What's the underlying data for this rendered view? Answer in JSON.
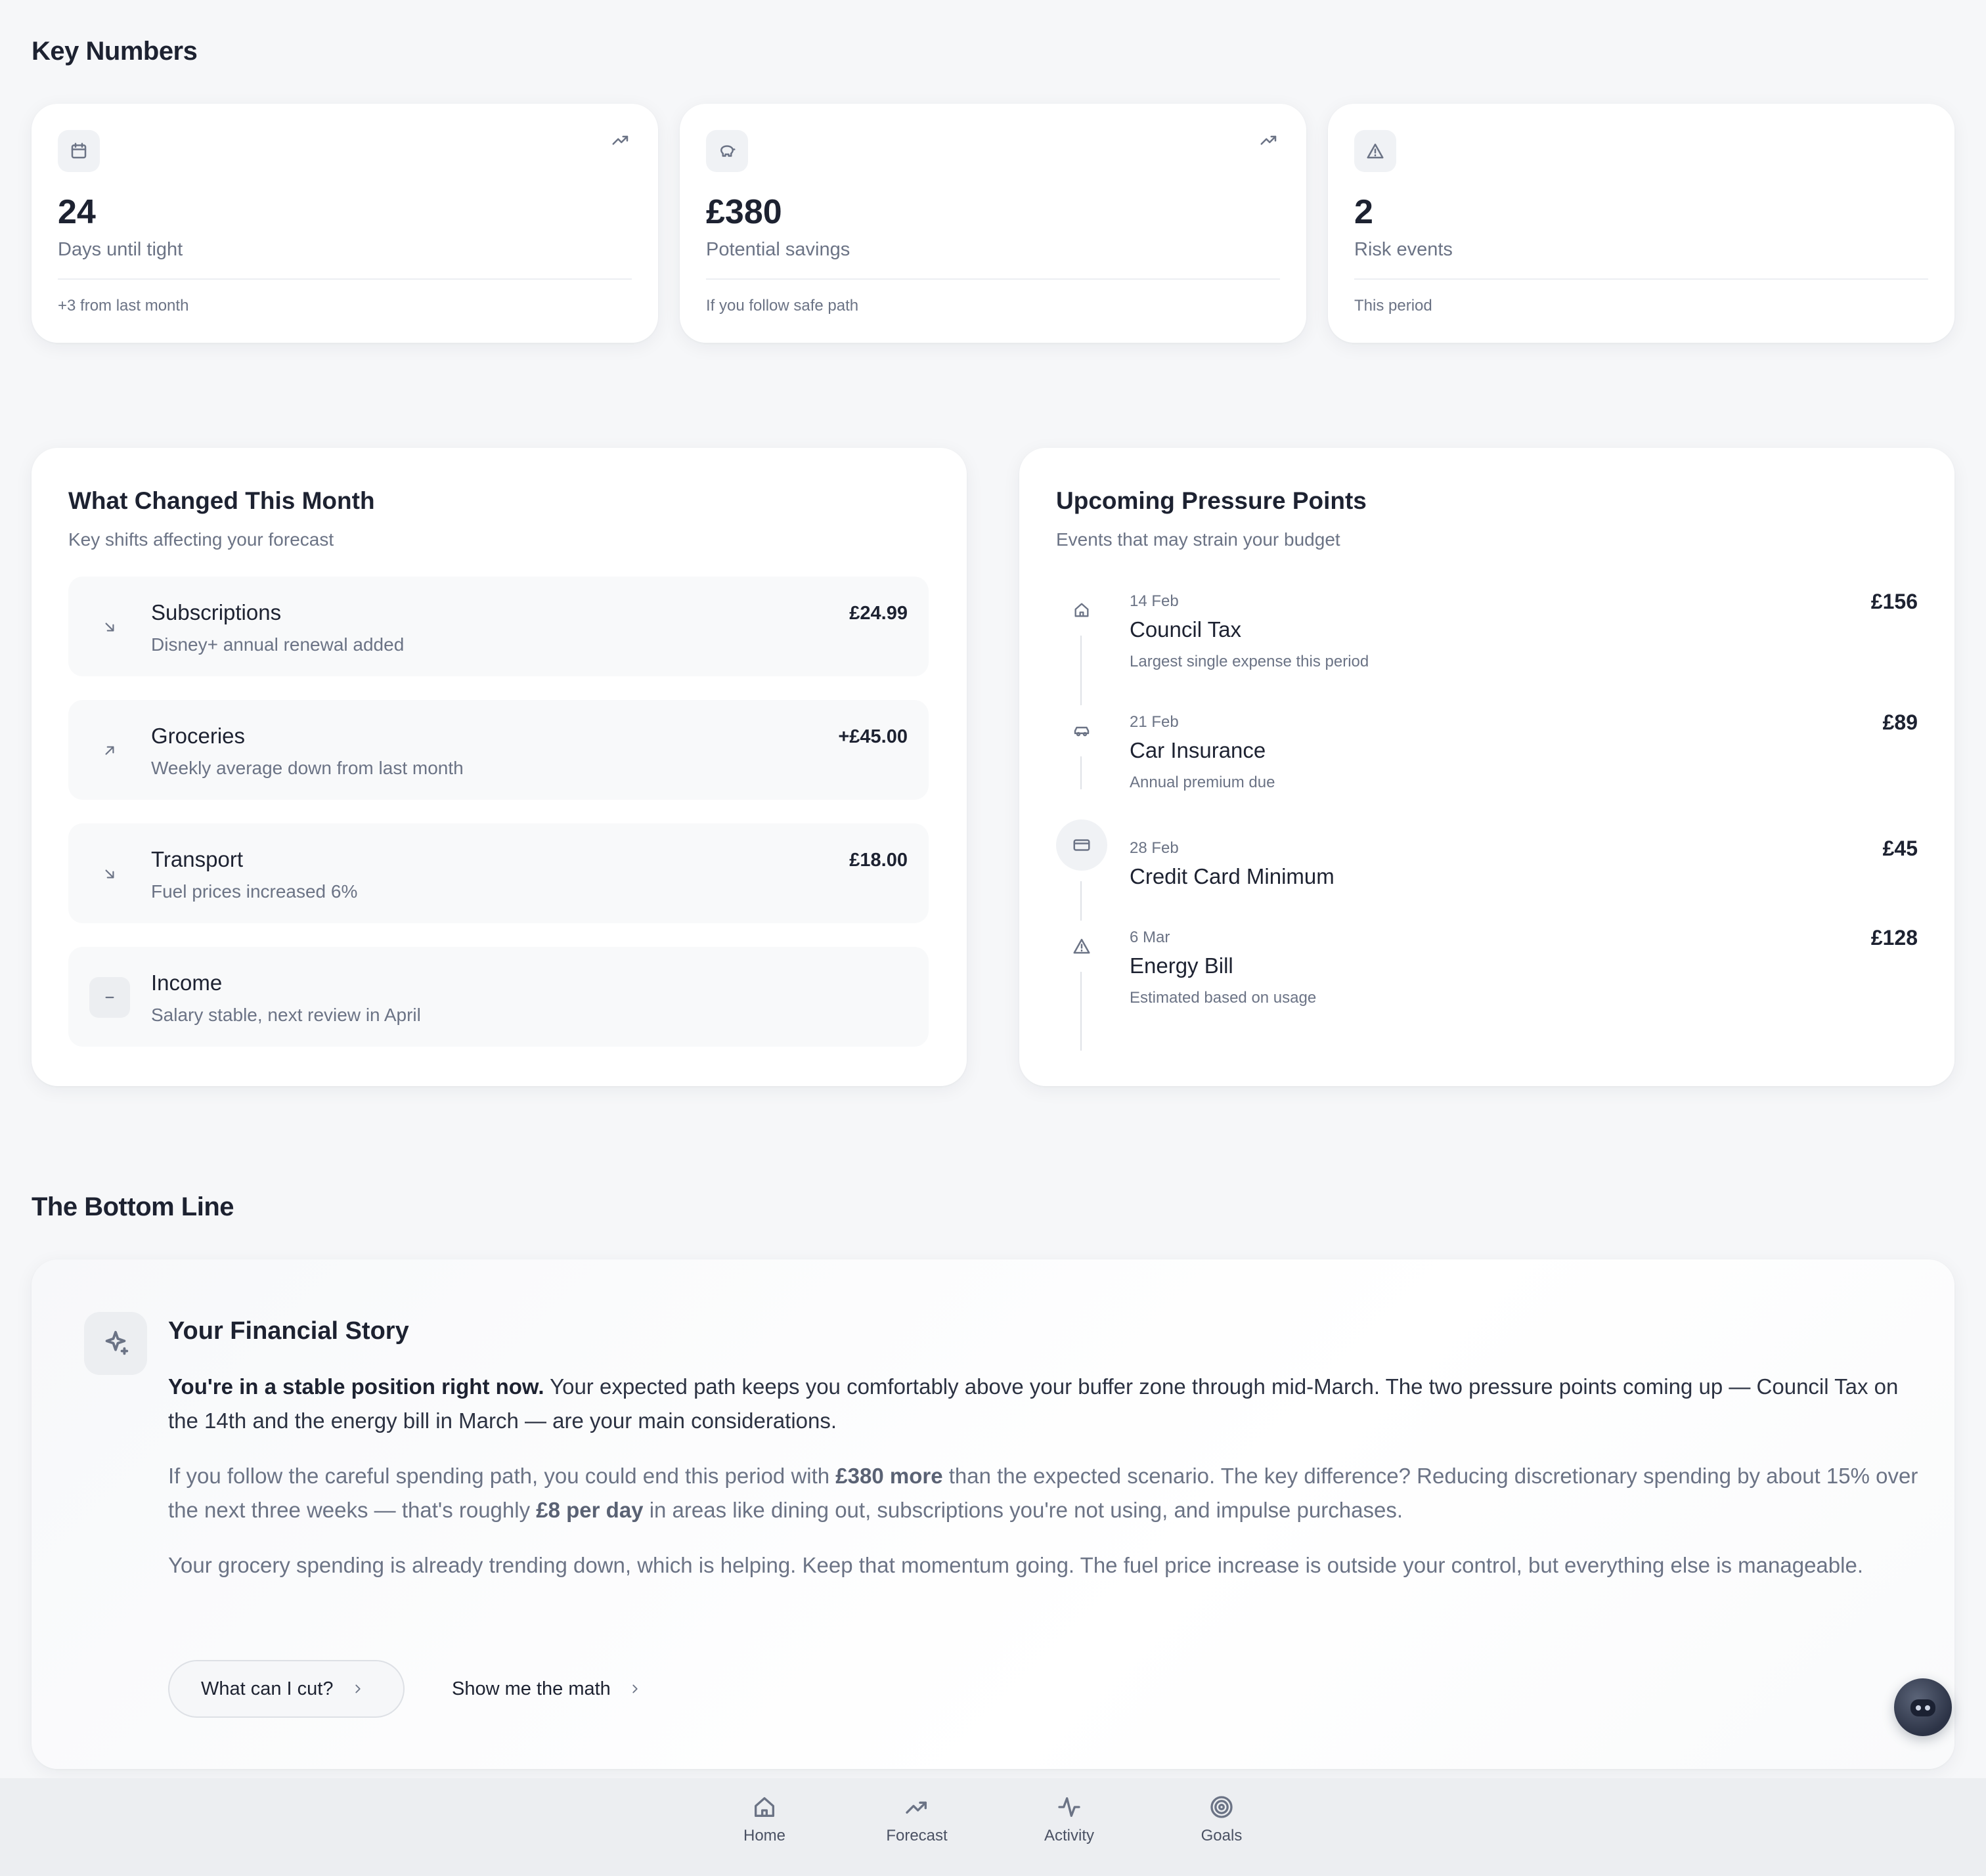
{
  "key_numbers": {
    "title": "Key Numbers",
    "cards": [
      {
        "icon": "calendar-icon",
        "trend": "trend-up-icon",
        "value": "24",
        "label": "Days until tight",
        "footnote": "+3 from last month"
      },
      {
        "icon": "piggy-bank-icon",
        "trend": "trend-up-icon",
        "value": "£380",
        "label": "Potential savings",
        "footnote": "If you follow safe path"
      },
      {
        "icon": "warning-icon",
        "trend": "",
        "value": "2",
        "label": "Risk events",
        "footnote": "This period"
      }
    ]
  },
  "what_changed": {
    "title": "What Changed This Month",
    "subtitle": "Key shifts affecting your forecast",
    "items": [
      {
        "icon": "arrow-down-right-icon",
        "name": "Subscriptions",
        "desc": "Disney+ annual renewal added",
        "amount": "£24.99"
      },
      {
        "icon": "arrow-up-right-icon",
        "name": "Groceries",
        "desc": "Weekly average down from last month",
        "amount": "+£45.00"
      },
      {
        "icon": "arrow-down-right-icon",
        "name": "Transport",
        "desc": "Fuel prices increased 6%",
        "amount": "£18.00"
      },
      {
        "icon": "minus-icon",
        "name": "Income",
        "desc": "Salary stable, next review in April",
        "amount": ""
      }
    ]
  },
  "pressure_points": {
    "title": "Upcoming Pressure Points",
    "subtitle": "Events that may strain your budget",
    "items": [
      {
        "icon": "home-icon",
        "date": "14 Feb",
        "name": "Council Tax",
        "desc": "Largest single expense this period",
        "amount": "£156"
      },
      {
        "icon": "car-icon",
        "date": "21 Feb",
        "name": "Car Insurance",
        "desc": "Annual premium due",
        "amount": "£89"
      },
      {
        "icon": "credit-card-icon",
        "date": "28 Feb",
        "name": "Credit Card Minimum",
        "desc": "",
        "amount": "£45"
      },
      {
        "icon": "warning-icon",
        "date": "6 Mar",
        "name": "Energy Bill",
        "desc": "Estimated based on usage",
        "amount": "£128"
      }
    ]
  },
  "bottom_line": {
    "title": "The Bottom Line",
    "story_title": "Your Financial Story",
    "p1_bold": "You're in a stable position right now.",
    "p1_rest": " Your expected path keeps you comfortably above your buffer zone through mid-March. The two pressure points coming up — Council Tax on the 14th and the energy bill in March — are your main considerations.",
    "p2_a": "If you follow the careful spending path, you could end this period with ",
    "p2_b": "£380 more",
    "p2_c": " than the expected scenario. The key difference? Reducing discretionary spending by about 15% over the next three weeks — that's roughly ",
    "p2_d": "£8 per day",
    "p2_e": " in areas like dining out, subscriptions you're not using, and impulse purchases.",
    "p3": "Your grocery spending is already trending down, which is helping. Keep that momentum going. The fuel price increase is outside your control, but everything else is manageable.",
    "btn_cut": "What can I cut?",
    "btn_math": "Show me the math"
  },
  "nav": {
    "items": [
      {
        "icon": "home-icon",
        "label": "Home"
      },
      {
        "icon": "trend-up-icon",
        "label": "Forecast"
      },
      {
        "icon": "activity-icon",
        "label": "Activity"
      },
      {
        "icon": "target-icon",
        "label": "Goals"
      }
    ]
  },
  "colors": {
    "background": "#f6f7f9",
    "card": "#ffffff",
    "text": "#1d2231",
    "muted": "#6b7385"
  }
}
